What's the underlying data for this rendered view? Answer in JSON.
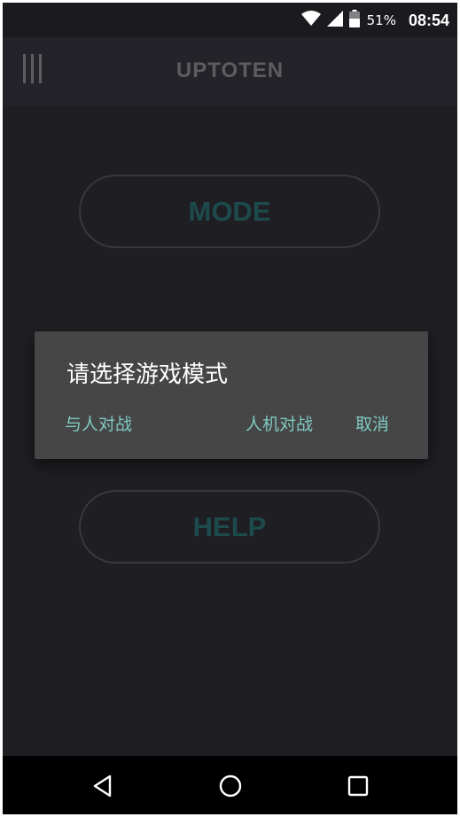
{
  "status_bar": {
    "battery_percent": "51%",
    "time": "08:54",
    "icons": [
      "wifi-icon",
      "signal-icon",
      "battery-icon"
    ]
  },
  "app_bar": {
    "title": "UPTOTEN",
    "menu_icon": "menu-icon"
  },
  "main": {
    "mode_button": "MODE",
    "help_button": "HELP"
  },
  "dialog": {
    "title": "请选择游戏模式",
    "buttons": {
      "pvp": "与人对战",
      "pve": "人机对战",
      "cancel": "取消"
    }
  },
  "nav_bar": {
    "icons": [
      "back-icon",
      "home-icon",
      "recents-icon"
    ]
  },
  "colors": {
    "background": "#1f1e23",
    "app_bar": "#242329",
    "dialog": "#464646",
    "accent": "#7fc8c1",
    "button_text": "#1d4b4c"
  }
}
